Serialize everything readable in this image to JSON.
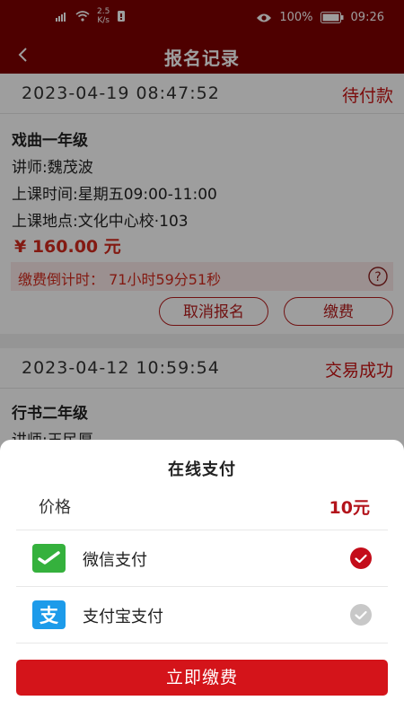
{
  "status_bar": {
    "net_speed_value": "2.5",
    "net_speed_unit": "K/s",
    "battery": "100%",
    "time": "09:26"
  },
  "header": {
    "title": "报名记录"
  },
  "records": [
    {
      "datetime": "2023-04-19 08:47:52",
      "status": "待付款",
      "course_name": "戏曲一年级",
      "teacher": "讲师:魏茂波",
      "schedule": "上课时间:星期五09:00-11:00",
      "location": "上课地点:文化中心校·103",
      "price": "¥ 160.00 元",
      "countdown": "缴费倒计时：  71小时59分51秒",
      "cancel_label": "取消报名",
      "pay_label": "缴费"
    },
    {
      "datetime": "2023-04-12 10:59:54",
      "status": "交易成功",
      "course_name": "行书二年级",
      "teacher": "讲师:王民厚"
    }
  ],
  "payment_sheet": {
    "title": "在线支付",
    "price_label": "价格",
    "price_value": "10元",
    "methods": [
      {
        "label": "微信支付",
        "icon": "wechat-pay-icon",
        "selected": true
      },
      {
        "label": "支付宝支付",
        "icon": "alipay-icon",
        "selected": false
      }
    ],
    "submit_label": "立即缴费"
  },
  "colors": {
    "header_bg": "#7e0000",
    "accent_red": "#d4141a",
    "wechat_green": "#35b13d",
    "alipay_blue": "#1d9bea"
  }
}
